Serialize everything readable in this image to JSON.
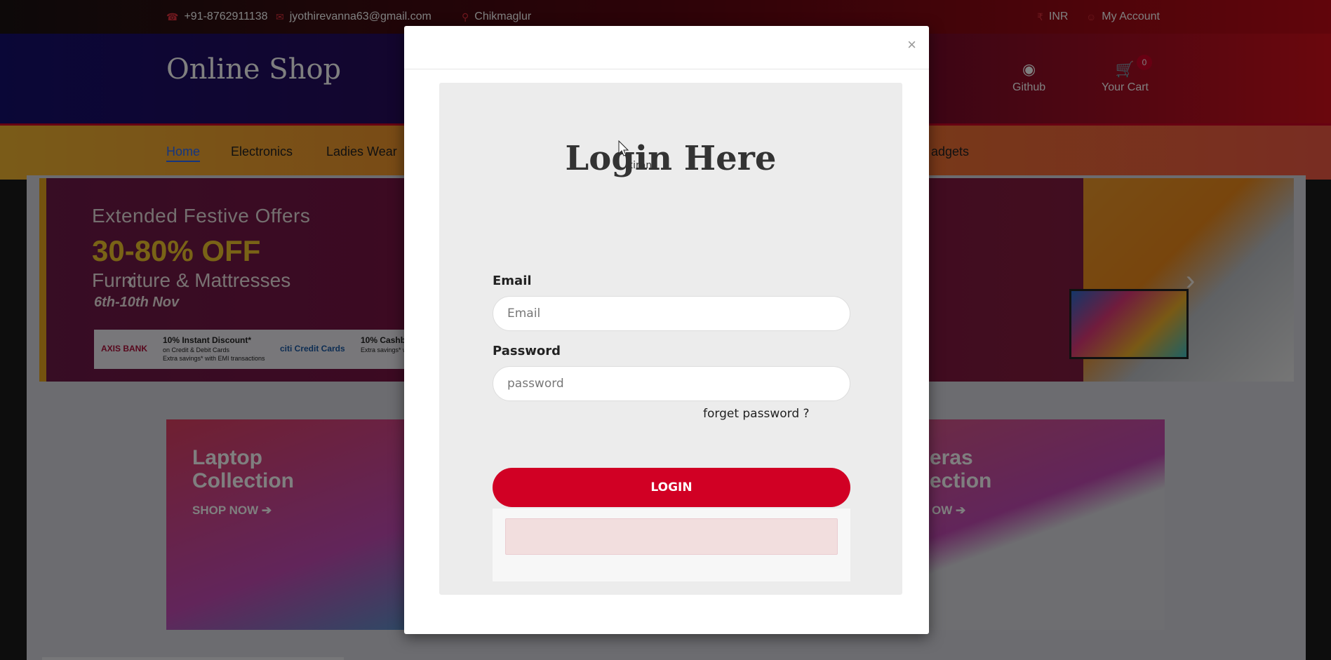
{
  "topbar": {
    "phone": "+91-8762911138",
    "email": "jyothirevanna63@gmail.com",
    "location": "Chikmaglur",
    "currency": "INR",
    "account": "My Account"
  },
  "header": {
    "logo": "Online Shop",
    "github_label": "Github",
    "cart_label": "Your Cart",
    "cart_count": "0"
  },
  "nav": {
    "items": [
      "Home",
      "Electronics",
      "Ladies Wear",
      "adgets"
    ]
  },
  "banner": {
    "line1": "Extended Festive Offers",
    "line2": "30-80% OFF",
    "line3": "Furniture & Mattresses",
    "line4": "6th-10th Nov",
    "offer1_bank": "AXIS BANK",
    "offer1_title": "10% Instant Discount*",
    "offer1_sub": "on Credit & Debit Cards",
    "offer1_sub2": "Extra savings* with EMI transactions",
    "offer2_bank": "citi Credit Cards",
    "offer2_title": "10% Cashbac",
    "offer2_sub": "Extra savings* with"
  },
  "collections": {
    "left_title_1": "Laptop",
    "left_title_2": "Collection",
    "left_cta": "SHOP NOW",
    "right_title_1": "eras",
    "right_title_2": "ection",
    "right_cta": "OW"
  },
  "modal": {
    "close": "×",
    "title": "Login Here",
    "email_label": "Email",
    "email_placeholder": "Email",
    "password_label": "Password",
    "password_placeholder": "password",
    "forget": "forget password ?",
    "login_button": "LOGIN"
  },
  "tooltip": "kiran",
  "colors": {
    "accent": "#d10024",
    "nav_active": "#2b6cff"
  }
}
